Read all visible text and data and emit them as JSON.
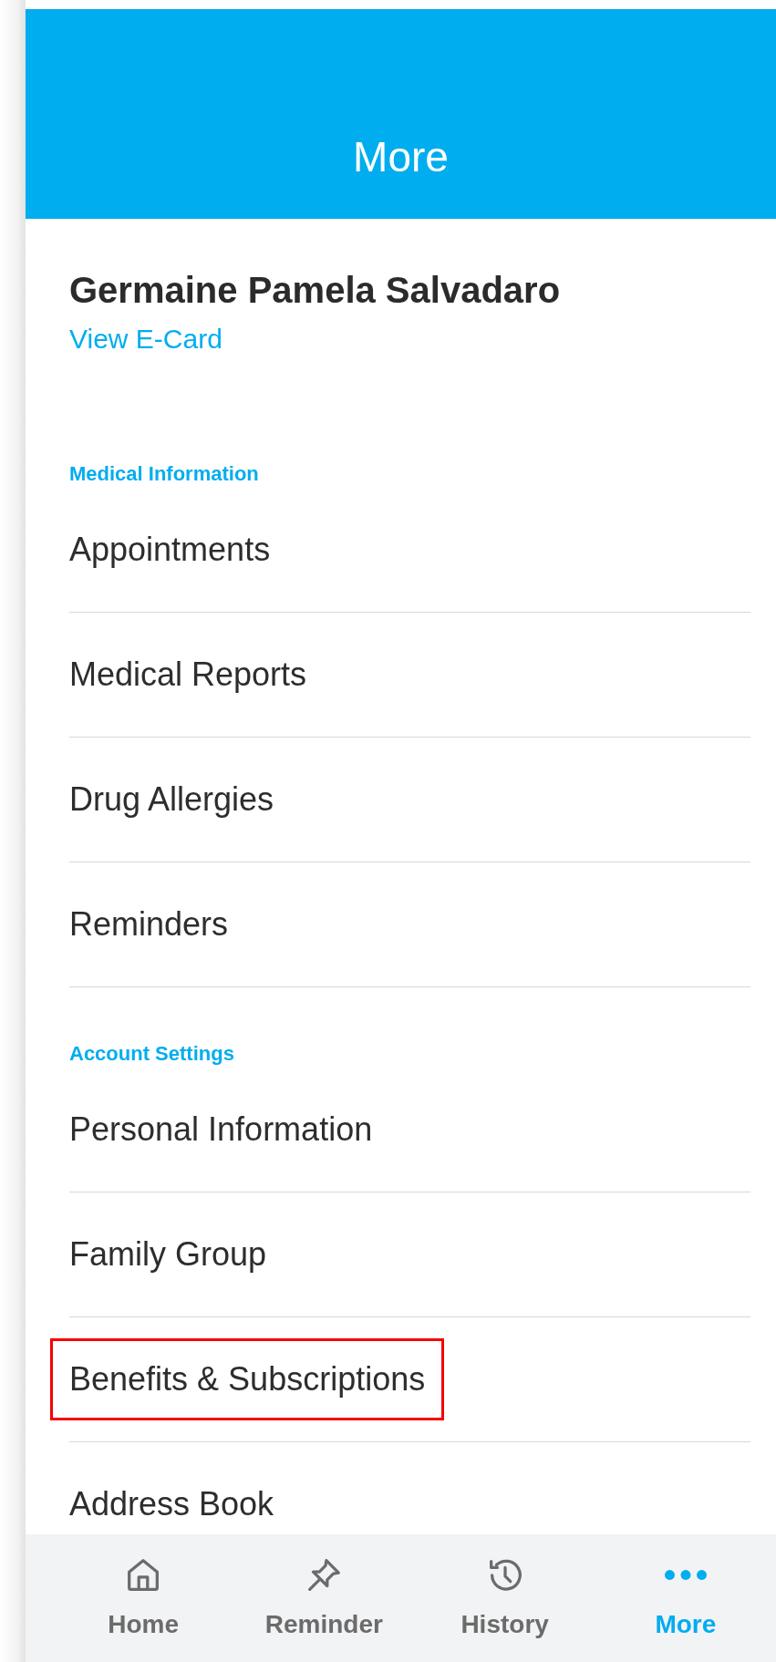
{
  "header": {
    "title": "More"
  },
  "profile": {
    "name": "Germaine Pamela Salvadaro",
    "link": "View E-Card"
  },
  "sections": [
    {
      "label": "Medical Information",
      "items": [
        {
          "label": "Appointments",
          "highlighted": false
        },
        {
          "label": "Medical Reports",
          "highlighted": false
        },
        {
          "label": "Drug Allergies",
          "highlighted": false
        },
        {
          "label": "Reminders",
          "highlighted": false
        }
      ]
    },
    {
      "label": "Account Settings",
      "items": [
        {
          "label": "Personal Information",
          "highlighted": false
        },
        {
          "label": "Family Group",
          "highlighted": false
        },
        {
          "label": "Benefits & Subscriptions",
          "highlighted": true
        },
        {
          "label": "Address Book",
          "highlighted": false
        }
      ]
    }
  ],
  "tab_bar": [
    {
      "kind": "home",
      "label": "Home",
      "selected": false
    },
    {
      "kind": "pin",
      "label": "Reminder",
      "selected": false
    },
    {
      "kind": "history",
      "label": "History",
      "selected": false
    },
    {
      "kind": "more",
      "label": "More",
      "selected": true
    }
  ]
}
